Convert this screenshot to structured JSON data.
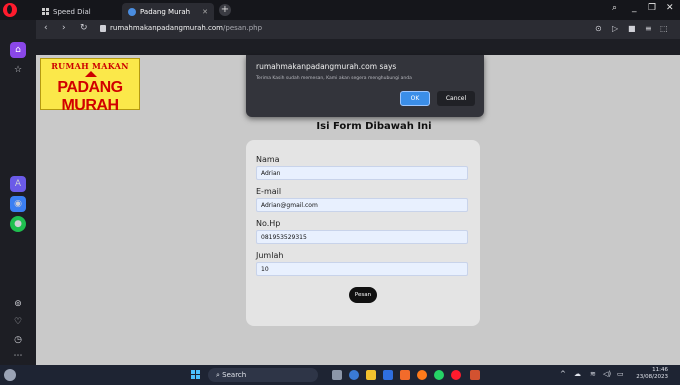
{
  "tabs": [
    {
      "label": "Speed Dial",
      "icon": "grid-icon"
    },
    {
      "label": "Padang Murah",
      "icon": "globe-icon"
    }
  ],
  "address": {
    "domain": "rumahmakanpadangmurah.com",
    "path": "/pesan.php"
  },
  "logo": {
    "top": "RUMAH MAKAN",
    "bottom": "PADANG MURAH"
  },
  "form": {
    "title": "Isi Form Dibawah Ini",
    "fields": [
      {
        "label": "Nama",
        "value": "Adrian"
      },
      {
        "label": "E-mail",
        "value": "Adrian@gmail.com"
      },
      {
        "label": "No.Hp",
        "value": "081953529315"
      },
      {
        "label": "Jumlah",
        "value": "10"
      }
    ],
    "submit": "Pesan"
  },
  "dialog": {
    "title": "rumahmakanpadangmurah.com says",
    "message": "Terima Kasih sudah memesan, Kami akan segera menghubungi anda",
    "ok": "OK",
    "cancel": "Cancel"
  },
  "taskbar": {
    "search": "Search",
    "time": "11:46",
    "date": "23/08/2023"
  }
}
